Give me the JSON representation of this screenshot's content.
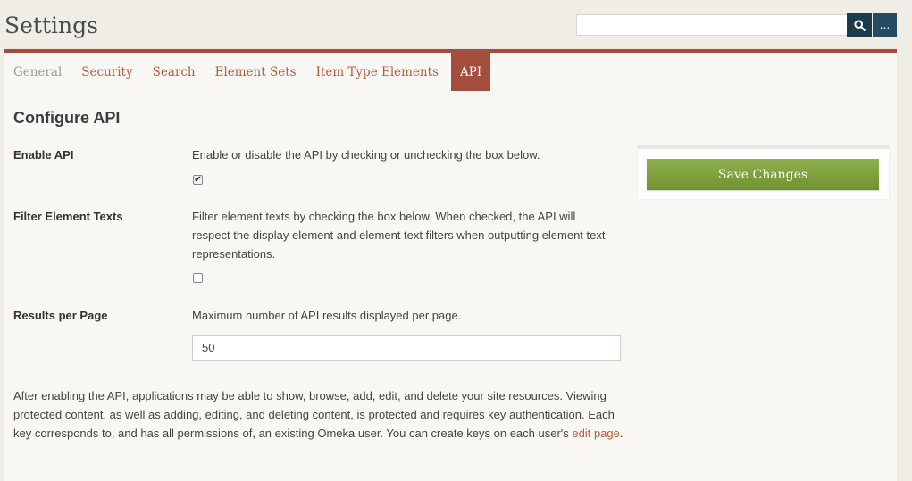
{
  "header": {
    "title": "Settings",
    "search_placeholder": "",
    "more_label": "..."
  },
  "tabs": [
    {
      "label": "General"
    },
    {
      "label": "Security"
    },
    {
      "label": "Search"
    },
    {
      "label": "Element Sets"
    },
    {
      "label": "Item Type Elements"
    },
    {
      "label": "API",
      "active": true
    }
  ],
  "form": {
    "heading": "Configure API",
    "enable_api": {
      "label": "Enable API",
      "description": "Enable or disable the API by checking or unchecking the box below.",
      "checked": true
    },
    "filter_element_texts": {
      "label": "Filter Element Texts",
      "description": "Filter element texts by checking the box below. When checked, the API will respect the display element and element text filters when outputting element text representations.",
      "checked": false
    },
    "results_per_page": {
      "label": "Results per Page",
      "description": "Maximum number of API results displayed per page.",
      "value": "50"
    },
    "info": {
      "text": "After enabling the API, applications may be able to show, browse, add, edit, and delete your site resources. Viewing protected content, as well as adding, editing, and deleting content, is protected and requires key authentication. Each key corresponds to, and has all permissions of, an existing Omeka user. You can create keys on each user's ",
      "link_text": "edit page",
      "suffix": "."
    }
  },
  "sidebar": {
    "save_label": "Save Changes"
  },
  "colors": {
    "accent": "#a34d3d",
    "link": "#b85c3c",
    "save_button": "#7da03c",
    "search_button": "#1d3b4f"
  }
}
